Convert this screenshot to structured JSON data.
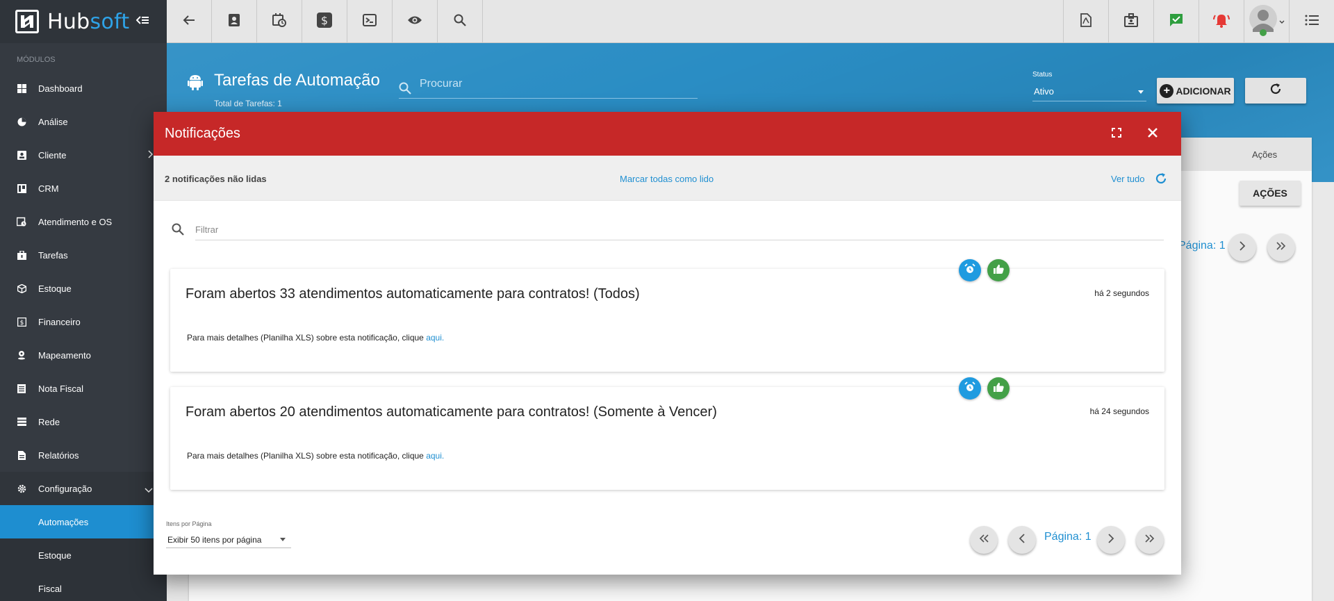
{
  "sidebar": {
    "brand": {
      "part1": "Hub",
      "part2": "soft"
    },
    "section_label": "MÓDULOS",
    "items": [
      {
        "label": "Dashboard",
        "icon": "dashboard-icon"
      },
      {
        "label": "Análise",
        "icon": "pie-chart-icon"
      },
      {
        "label": "Cliente",
        "icon": "contact-card-icon"
      },
      {
        "label": "CRM",
        "icon": "crm-board-icon"
      },
      {
        "label": "Atendimento e OS",
        "icon": "calendar-clock-icon"
      },
      {
        "label": "Tarefas",
        "icon": "tasks-icon"
      },
      {
        "label": "Estoque",
        "icon": "box-icon"
      },
      {
        "label": "Financeiro",
        "icon": "money-icon"
      },
      {
        "label": "Mapeamento",
        "icon": "map-pin-icon"
      },
      {
        "label": "Nota Fiscal",
        "icon": "invoice-icon"
      },
      {
        "label": "Rede",
        "icon": "network-icon"
      },
      {
        "label": "Relatórios",
        "icon": "report-icon"
      },
      {
        "label": "Configuração",
        "icon": "gear-icon"
      }
    ],
    "sub_items": [
      {
        "label": "Automações",
        "active": true
      },
      {
        "label": "Estoque",
        "active": false
      },
      {
        "label": "Fiscal",
        "active": false
      }
    ]
  },
  "topbar": {
    "left_icons": [
      "back-arrow-icon",
      "contact-icon",
      "calendar-clock-icon",
      "dollar-icon",
      "terminal-icon",
      "eye-icon",
      "search-icon"
    ],
    "right_icons": [
      "pdf-file-icon",
      "badge-icon",
      "chat-check-icon",
      "alarm-bell-icon",
      "user-avatar-icon",
      "menu-list-icon"
    ]
  },
  "page": {
    "title": "Tarefas de Automação",
    "subtitle": "Total de Tarefas: 1",
    "search_placeholder": "Procurar",
    "status_label": "Status",
    "status_value": "Ativo",
    "add_label": "ADICIONAR",
    "column_acoes": "Ações",
    "acoes_button": "AÇÕES",
    "page_label": "Página: 1"
  },
  "modal": {
    "title": "Notificações",
    "unread_text": "2 notificações não lidas",
    "mark_all": "Marcar todas como lido",
    "see_all": "Ver tudo",
    "filter_placeholder": "Filtrar",
    "notifications": [
      {
        "title": "Foram abertos 33 atendimentos automaticamente para contratos! (Todos)",
        "time": "há 2 segundos",
        "body": "Para mais detalhes (Planilha XLS) sobre esta notificação, clique ",
        "link": "aqui."
      },
      {
        "title": "Foram abertos 20 atendimentos automaticamente para contratos! (Somente à Vencer)",
        "time": "há 24 segundos",
        "body": "Para mais detalhes (Planilha XLS) sobre esta notificação, clique ",
        "link": "aqui."
      }
    ],
    "items_per_page_label": "Itens por Página",
    "items_per_page_value": "Exibir 50 itens por página",
    "page_label": "Página: 1"
  },
  "colors": {
    "header_red": "#c62828",
    "accent_blue": "#1f8fd1",
    "sidebar_bg": "#353a41",
    "active_item": "#1e8ed0",
    "alert_red": "#e53935",
    "check_green": "#43a047"
  }
}
